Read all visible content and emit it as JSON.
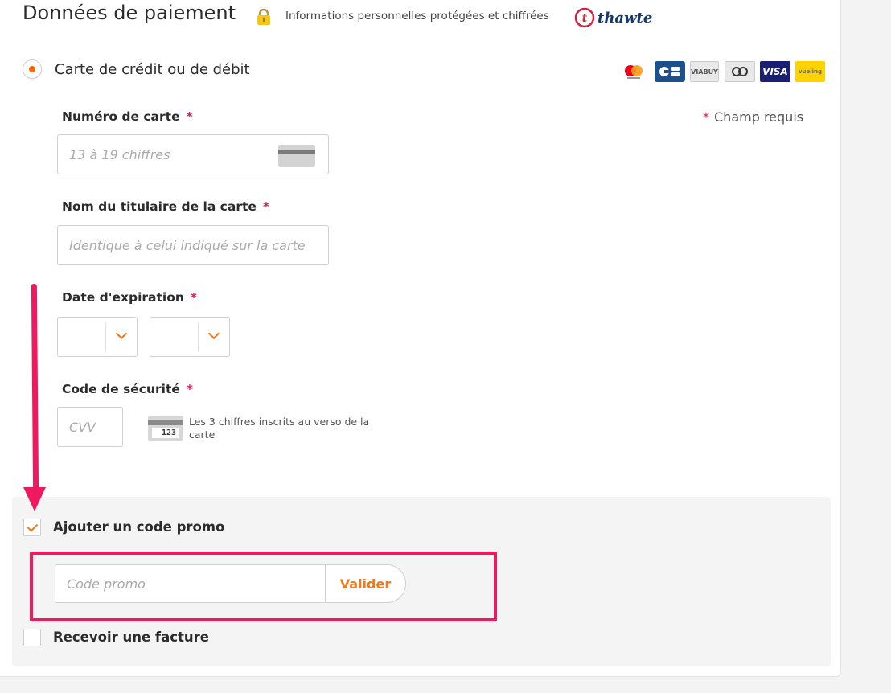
{
  "header": {
    "title": "Données de paiement",
    "secure_text": "Informations personnelles protégées et chiffrées",
    "thawte_label": "thawte"
  },
  "payment_method": {
    "label": "Carte de crédit ou de débit",
    "selected": true,
    "brands": [
      "mastercard",
      "CB",
      "VIABUY",
      "entropay",
      "VISA",
      "vueling"
    ]
  },
  "required_note": {
    "star": "*",
    "text": "Champ requis"
  },
  "fields": {
    "card_number": {
      "label": "Numéro de carte",
      "required_mark": "*",
      "placeholder": "13 à 19 chiffres"
    },
    "holder_name": {
      "label": "Nom du titulaire de la carte",
      "required_mark": "*",
      "placeholder": "Identique à celui indiqué sur la carte"
    },
    "expiry": {
      "label": "Date d'expiration",
      "required_mark": "*",
      "month_value": "",
      "year_value": ""
    },
    "cvv": {
      "label": "Code de sécurité",
      "required_mark": "*",
      "placeholder": "CVV",
      "help": "Les 3 chiffres inscrits au verso de la carte",
      "icon_digits": "123"
    }
  },
  "promo": {
    "checkbox_label": "Ajouter un code promo",
    "checked": true,
    "input_placeholder": "Code promo",
    "button_label": "Valider"
  },
  "invoice": {
    "checkbox_label": "Recevoir une facture",
    "checked": false
  },
  "colors": {
    "accent_orange": "#f07a1a",
    "annotation_pink": "#f0195f",
    "required_star": "#e8145a"
  }
}
